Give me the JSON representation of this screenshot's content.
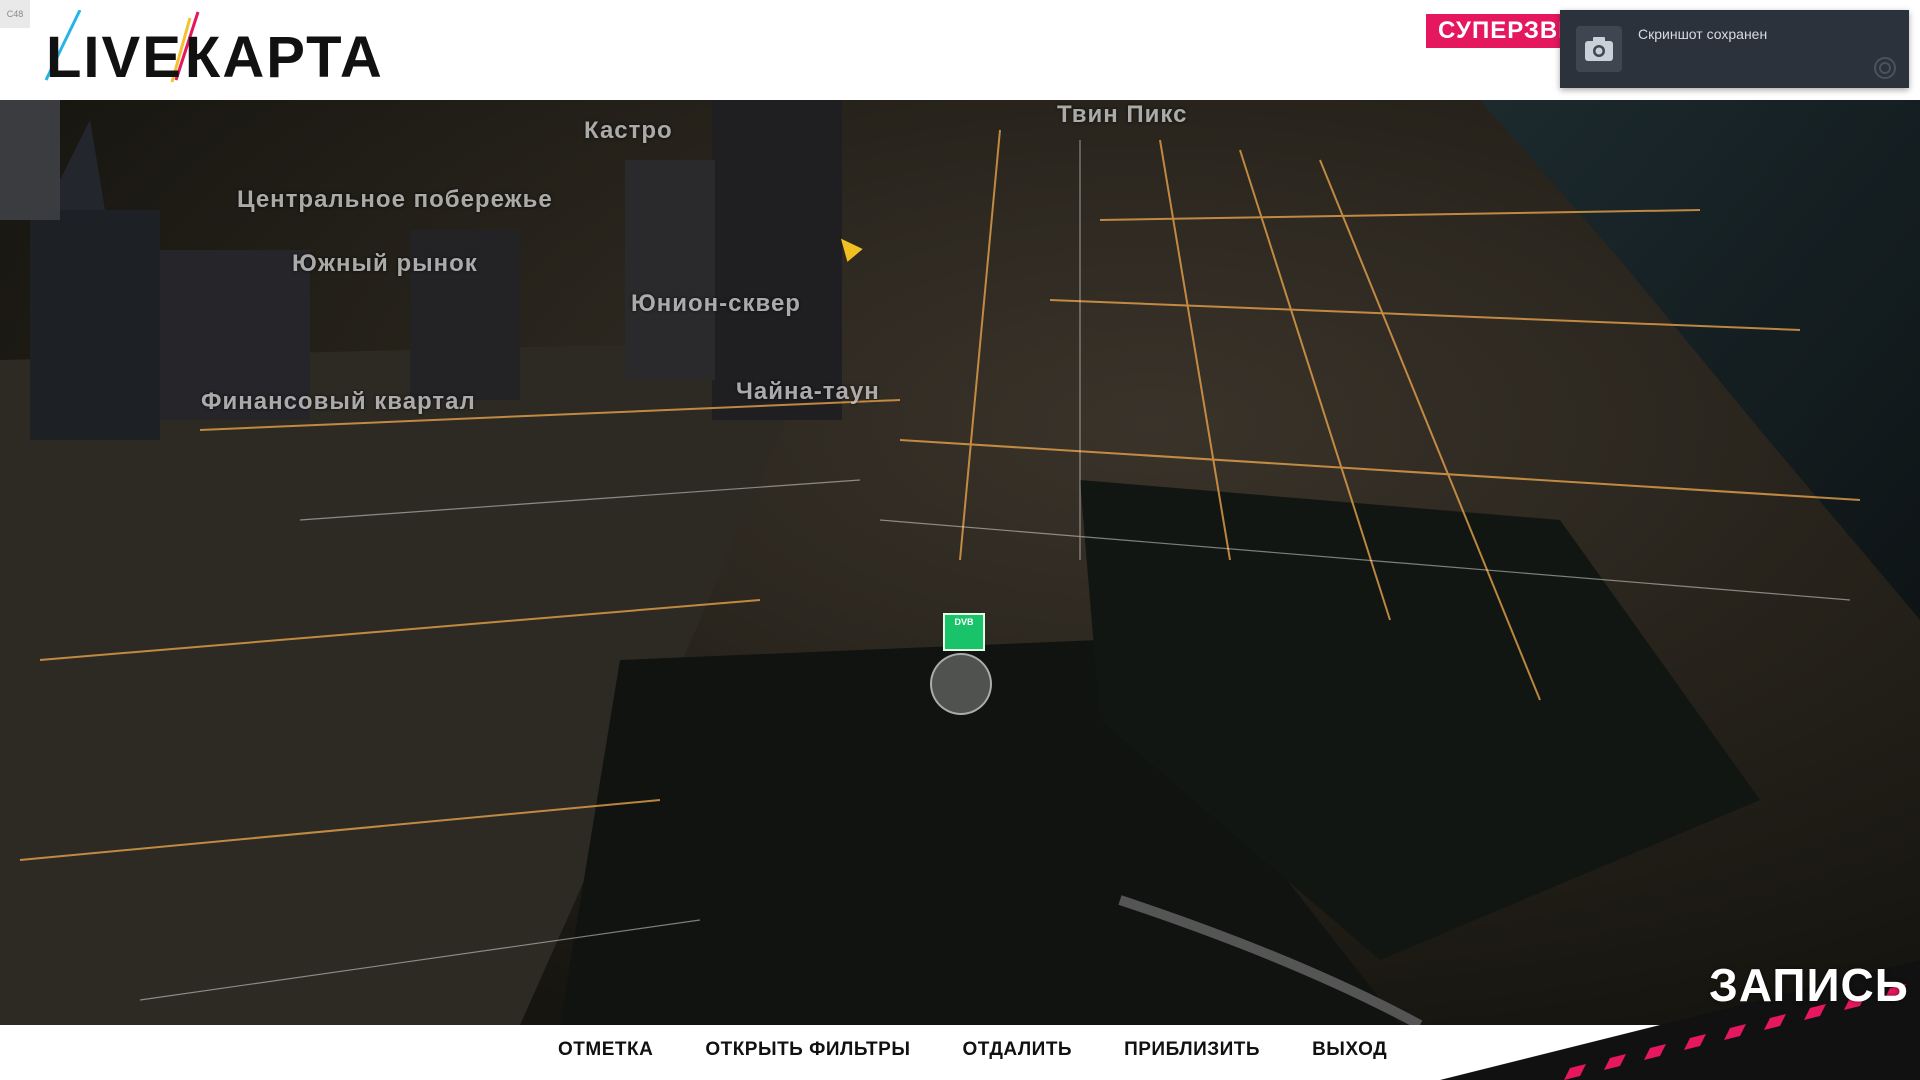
{
  "hud": {
    "fps_label": "С48"
  },
  "logo": {
    "live": "LIVE",
    "karta": "КАРТА"
  },
  "banner": {
    "label": "СУПЕРЗВЕ"
  },
  "toast": {
    "message": "Скриншот сохранен",
    "icon": "camera-icon"
  },
  "map": {
    "districts": [
      "Кастро",
      "Твин Пикс",
      "Центральное побережье",
      "Южный рынок",
      "Юнион-сквер",
      "Финансовый квартал",
      "Чайна-таун"
    ],
    "shop_label": "DVB"
  },
  "menu": {
    "items": [
      "ОТМЕТКА",
      "ОТКРЫТЬ ФИЛЬТРЫ",
      "ОТДАЛИТЬ",
      "ПРИБЛИЗИТЬ",
      "ВЫХОД"
    ]
  },
  "record": {
    "label": "ЗАПИСЬ"
  },
  "colors": {
    "accent": "#e5175e",
    "toast_bg": "#2b323b",
    "shop": "#19c36a"
  }
}
